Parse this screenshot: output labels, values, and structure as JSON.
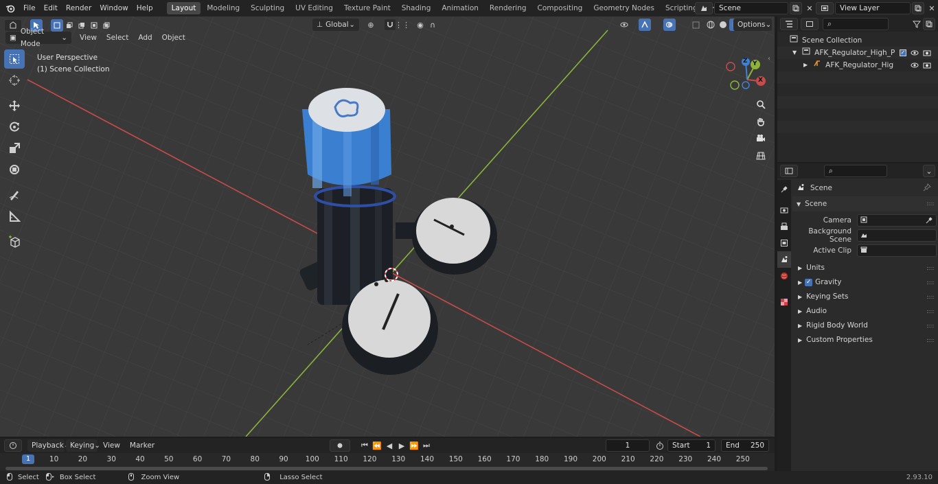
{
  "topbar": {
    "menus": [
      "File",
      "Edit",
      "Render",
      "Window",
      "Help"
    ],
    "workspaces": [
      "Layout",
      "Modeling",
      "Sculpting",
      "UV Editing",
      "Texture Paint",
      "Shading",
      "Animation",
      "Rendering",
      "Compositing",
      "Geometry Nodes",
      "Scripting"
    ],
    "active_workspace": "Layout",
    "add_workspace": "+",
    "scene_name": "Scene",
    "view_layer": "View Layer"
  },
  "viewport": {
    "mode": "Object Mode",
    "menus": [
      "View",
      "Select",
      "Add",
      "Object"
    ],
    "transform_orientation": "Global",
    "options_label": "Options",
    "overlay_title": "User Perspective",
    "overlay_subtitle": "(1) Scene Collection",
    "gizmo_axes": {
      "x": "X",
      "y": "Y",
      "z": "Z"
    }
  },
  "outliner": {
    "search_placeholder": "",
    "rows": [
      {
        "label": "Scene Collection"
      },
      {
        "label": "AFK_Regulator_High_Pressure"
      },
      {
        "label": "AFK_Regulator_High_Pre"
      }
    ]
  },
  "properties": {
    "search_placeholder": "",
    "context": "Scene",
    "panel": "Scene",
    "fields": [
      {
        "label": "Camera",
        "value": ""
      },
      {
        "label": "Background Scene",
        "value": ""
      },
      {
        "label": "Active Clip",
        "value": ""
      }
    ],
    "sections": [
      "Units",
      "Gravity",
      "Keying Sets",
      "Audio",
      "Rigid Body World",
      "Custom Properties"
    ],
    "gravity_enabled": true
  },
  "timeline": {
    "menus": [
      "Playback",
      "Keying",
      "View",
      "Marker"
    ],
    "current_frame": "1",
    "start_label": "Start",
    "start_value": "1",
    "end_label": "End",
    "end_value": "250",
    "frame_marks": [
      "10",
      "20",
      "30",
      "40",
      "50",
      "60",
      "70",
      "80",
      "90",
      "100",
      "110",
      "120",
      "130",
      "140",
      "150",
      "160",
      "170",
      "180",
      "190",
      "200",
      "210",
      "220",
      "230",
      "240",
      "250"
    ]
  },
  "statusbar": {
    "items": [
      "Select",
      "Box Select",
      "Zoom View",
      "Lasso Select"
    ],
    "version": "2.93.10"
  },
  "colors": {
    "accent": "#4772b3",
    "x_axis": "#c84b4b",
    "y_axis": "#8cb33a",
    "z_axis": "#3c82d8"
  }
}
